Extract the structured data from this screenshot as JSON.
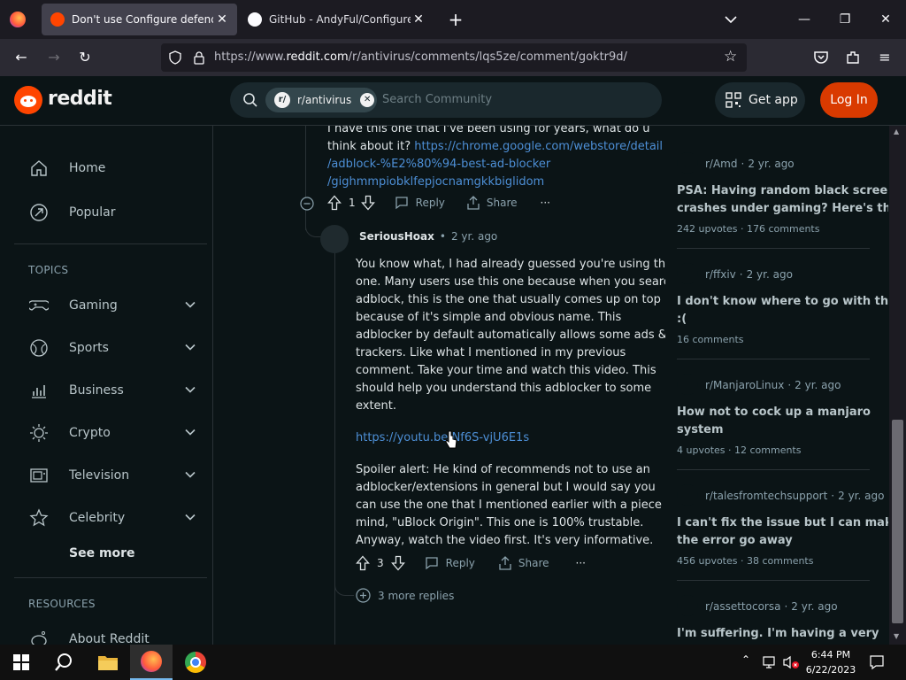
{
  "browser": {
    "tabs": [
      {
        "title": "Don't use Configure defender!! Use...",
        "active": true
      },
      {
        "title": "GitHub - AndyFul/ConfigureDefender",
        "active": false
      }
    ],
    "url_prefix": "https://www.",
    "url_domain": "reddit.com",
    "url_path": "/r/antivirus/comments/lqs5ze/comment/goktr9d/"
  },
  "header": {
    "brand": "reddit",
    "community_chip": "r/antivirus",
    "search_placeholder": "Search Community",
    "get_app": "Get app",
    "login": "Log In"
  },
  "sidebar": {
    "top": [
      {
        "label": "Home",
        "icon": "home-icon"
      },
      {
        "label": "Popular",
        "icon": "popular-icon"
      }
    ],
    "topics_label": "TOPICS",
    "topics": [
      {
        "label": "Gaming",
        "icon": "gamepad-icon"
      },
      {
        "label": "Sports",
        "icon": "ball-icon"
      },
      {
        "label": "Business",
        "icon": "chart-icon"
      },
      {
        "label": "Crypto",
        "icon": "crypto-icon"
      },
      {
        "label": "Television",
        "icon": "tv-icon"
      },
      {
        "label": "Celebrity",
        "icon": "star-icon"
      }
    ],
    "see_more": "See more",
    "resources_label": "RESOURCES",
    "resources": [
      {
        "label": "About Reddit",
        "icon": "reddit-icon"
      }
    ]
  },
  "comments": {
    "parent": {
      "text_line1": "I have this one that I've been using for years, what do u",
      "text_line2": "think about it?",
      "link_part1": "https://chrome.google.com/webstore/detail",
      "link_part2": "/adblock-%E2%80%94-best-ad-blocker",
      "link_part3": "/gighmmpiobklfepjocnamgkkbiglidom",
      "votes": "1",
      "reply": "Reply",
      "share": "Share",
      "more": "···"
    },
    "reply": {
      "author": "SeriousHoax",
      "time": "2 yr. ago",
      "dot": "•",
      "para1": [
        "You know what, I had already guessed you're using this",
        "one. Many users use this one because when you search",
        "adblock, this is the one that usually comes up on top",
        "because of it's simple and obvious name. This",
        "adblocker by default automatically allows some ads &",
        "trackers. Like what I mentioned in my previous",
        "comment. Take your time and watch this video. This",
        "should help you understand this adblocker to some",
        "extent."
      ],
      "link": "https://youtu.be/Nf6S-vjU6E1s",
      "para2": [
        "Spoiler alert: He kind of recommends not to use an",
        "adblocker/extensions in general but I would say you",
        "can use the one that I mentioned earlier with a piece of",
        "mind, \"uBlock Origin\". This one is 100% trustable.",
        "Anyway, watch the video first. It's very informative."
      ],
      "votes": "3",
      "reply": "Reply",
      "share": "Share",
      "more": "···"
    },
    "more_replies": "3 more replies"
  },
  "related": [
    {
      "sub": "r/Amd",
      "time": "2 yr. ago",
      "title": [
        "PSA: Having random black screen",
        "crashes under gaming? Here's th..."
      ],
      "stats": "242 upvotes · 176 comments"
    },
    {
      "sub": "r/ffxiv",
      "time": "2 yr. ago",
      "title": [
        "I don't know where to go with this",
        ":("
      ],
      "stats": "16 comments"
    },
    {
      "sub": "r/ManjaroLinux",
      "time": "2 yr. ago",
      "title": [
        "How not to cock up a manjaro",
        "system"
      ],
      "stats": "4 upvotes · 12 comments"
    },
    {
      "sub": "r/talesfromtechsupport",
      "time": "2 yr. ago",
      "title": [
        "I can't fix the issue but I can make",
        "the error go away"
      ],
      "stats": "456 upvotes · 38 comments"
    },
    {
      "sub": "r/assettocorsa",
      "time": "2 yr. ago",
      "title": [
        "I'm suffering. I'm having a very",
        ""
      ],
      "stats": ""
    }
  ],
  "related_dot": "·",
  "taskbar": {
    "time": "6:44 PM",
    "date": "6/22/2023"
  },
  "colors": {
    "accent": "#ff4500",
    "login": "#d93a00",
    "link": "#4d8fd6"
  }
}
